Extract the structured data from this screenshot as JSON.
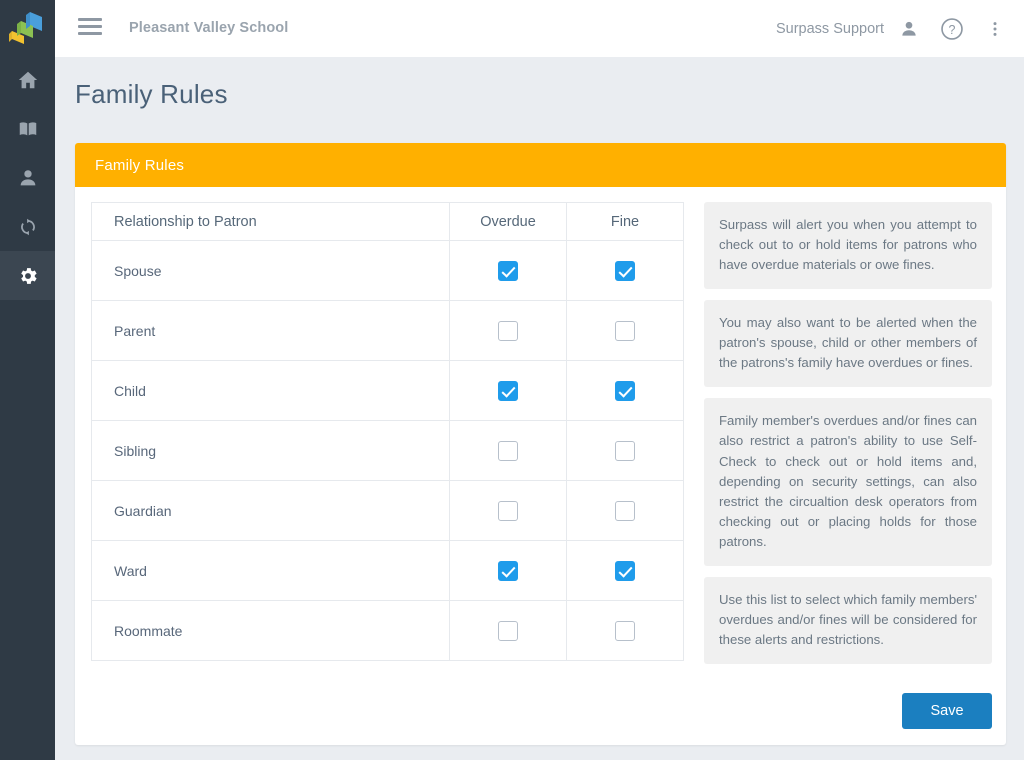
{
  "colors": {
    "sidebar_bg": "#2f3a45",
    "sidebar_active_bg": "#3b4651",
    "page_bg": "#eaedf1",
    "card_header_orange": "#ffb000",
    "checkbox_blue": "#1f9ceb",
    "save_blue": "#1b7fc0",
    "title_text": "#4a6178",
    "logo_yellow": "#f2c230",
    "logo_green": "#8cc152",
    "logo_blue": "#4a9fdc"
  },
  "sidebar": {
    "logo": {
      "name": "surpass-logo",
      "alt": "Surpass"
    },
    "items": [
      {
        "icon": "home-icon",
        "label": "Home",
        "active": false
      },
      {
        "icon": "book-icon",
        "label": "Catalog",
        "active": false
      },
      {
        "icon": "person-icon",
        "label": "Patrons",
        "active": false
      },
      {
        "icon": "sync-icon",
        "label": "Circulation",
        "active": false
      },
      {
        "icon": "gear-icon",
        "label": "Settings",
        "active": true
      }
    ]
  },
  "topbar": {
    "menu_icon": "hamburger-icon",
    "school_name": "Pleasant Valley School",
    "support_label": "Surpass Support",
    "user_icon": "user-icon",
    "help_icon": "help-circle-icon",
    "more_icon": "more-vertical-icon"
  },
  "page": {
    "title": "Family Rules"
  },
  "card": {
    "header_title": "Family Rules",
    "table": {
      "columns": [
        "Relationship to Patron",
        "Overdue",
        "Fine"
      ],
      "rows": [
        {
          "relationship": "Spouse",
          "overdue": true,
          "fine": true
        },
        {
          "relationship": "Parent",
          "overdue": false,
          "fine": false
        },
        {
          "relationship": "Child",
          "overdue": true,
          "fine": true
        },
        {
          "relationship": "Sibling",
          "overdue": false,
          "fine": false
        },
        {
          "relationship": "Guardian",
          "overdue": false,
          "fine": false
        },
        {
          "relationship": "Ward",
          "overdue": true,
          "fine": true
        },
        {
          "relationship": "Roommate",
          "overdue": false,
          "fine": false
        }
      ]
    },
    "info_panels": [
      "Surpass will alert you when you attempt to check out to or hold items for patrons who have overdue materials or owe fines.",
      "You may also want to be alerted when the patron's spouse, child or other members of the patrons's family have overdues or fines.",
      "Family member's overdues and/or fines can also restrict a patron's ability to use Self-Check to check out or hold items and, depending on security settings, can also restrict the circualtion desk operators from checking out or placing holds for those patrons.",
      "Use this list to select which family members' overdues and/or fines will be considered for these alerts and restrictions."
    ],
    "save_label": "Save"
  }
}
